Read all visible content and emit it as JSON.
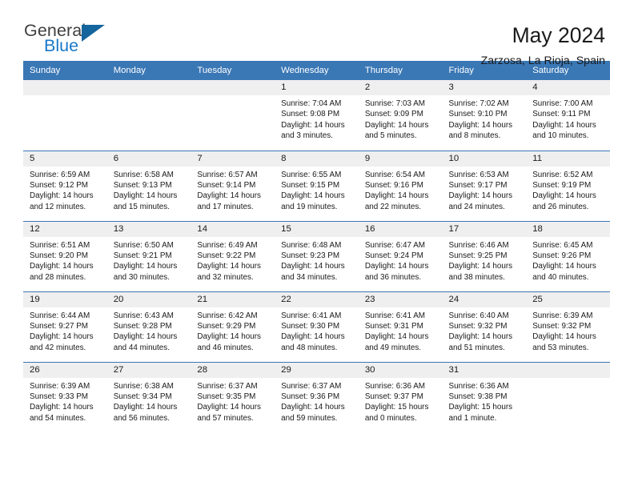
{
  "brand": {
    "name_part1": "General",
    "name_part2": "Blue",
    "triangle_color": "#14659e",
    "blue": "#1878c8"
  },
  "header": {
    "title": "May 2024",
    "subtitle": "Zarzosa, La Rioja, Spain"
  },
  "theme": {
    "header_bg": "#3a77b5",
    "daynum_bg": "#efefef",
    "row_border": "#3a77b5"
  },
  "weekday_headers": [
    "Sunday",
    "Monday",
    "Tuesday",
    "Wednesday",
    "Thursday",
    "Friday",
    "Saturday"
  ],
  "labels": {
    "sunrise_prefix": "Sunrise:",
    "sunset_prefix": "Sunset:",
    "daylight_prefix": "Daylight:"
  },
  "weeks": [
    [
      {
        "blank": true
      },
      {
        "blank": true
      },
      {
        "blank": true
      },
      {
        "day": "1",
        "sunrise": "Sunrise: 7:04 AM",
        "sunset": "Sunset: 9:08 PM",
        "daylight": "Daylight: 14 hours and 3 minutes."
      },
      {
        "day": "2",
        "sunrise": "Sunrise: 7:03 AM",
        "sunset": "Sunset: 9:09 PM",
        "daylight": "Daylight: 14 hours and 5 minutes."
      },
      {
        "day": "3",
        "sunrise": "Sunrise: 7:02 AM",
        "sunset": "Sunset: 9:10 PM",
        "daylight": "Daylight: 14 hours and 8 minutes."
      },
      {
        "day": "4",
        "sunrise": "Sunrise: 7:00 AM",
        "sunset": "Sunset: 9:11 PM",
        "daylight": "Daylight: 14 hours and 10 minutes."
      }
    ],
    [
      {
        "day": "5",
        "sunrise": "Sunrise: 6:59 AM",
        "sunset": "Sunset: 9:12 PM",
        "daylight": "Daylight: 14 hours and 12 minutes."
      },
      {
        "day": "6",
        "sunrise": "Sunrise: 6:58 AM",
        "sunset": "Sunset: 9:13 PM",
        "daylight": "Daylight: 14 hours and 15 minutes."
      },
      {
        "day": "7",
        "sunrise": "Sunrise: 6:57 AM",
        "sunset": "Sunset: 9:14 PM",
        "daylight": "Daylight: 14 hours and 17 minutes."
      },
      {
        "day": "8",
        "sunrise": "Sunrise: 6:55 AM",
        "sunset": "Sunset: 9:15 PM",
        "daylight": "Daylight: 14 hours and 19 minutes."
      },
      {
        "day": "9",
        "sunrise": "Sunrise: 6:54 AM",
        "sunset": "Sunset: 9:16 PM",
        "daylight": "Daylight: 14 hours and 22 minutes."
      },
      {
        "day": "10",
        "sunrise": "Sunrise: 6:53 AM",
        "sunset": "Sunset: 9:17 PM",
        "daylight": "Daylight: 14 hours and 24 minutes."
      },
      {
        "day": "11",
        "sunrise": "Sunrise: 6:52 AM",
        "sunset": "Sunset: 9:19 PM",
        "daylight": "Daylight: 14 hours and 26 minutes."
      }
    ],
    [
      {
        "day": "12",
        "sunrise": "Sunrise: 6:51 AM",
        "sunset": "Sunset: 9:20 PM",
        "daylight": "Daylight: 14 hours and 28 minutes."
      },
      {
        "day": "13",
        "sunrise": "Sunrise: 6:50 AM",
        "sunset": "Sunset: 9:21 PM",
        "daylight": "Daylight: 14 hours and 30 minutes."
      },
      {
        "day": "14",
        "sunrise": "Sunrise: 6:49 AM",
        "sunset": "Sunset: 9:22 PM",
        "daylight": "Daylight: 14 hours and 32 minutes."
      },
      {
        "day": "15",
        "sunrise": "Sunrise: 6:48 AM",
        "sunset": "Sunset: 9:23 PM",
        "daylight": "Daylight: 14 hours and 34 minutes."
      },
      {
        "day": "16",
        "sunrise": "Sunrise: 6:47 AM",
        "sunset": "Sunset: 9:24 PM",
        "daylight": "Daylight: 14 hours and 36 minutes."
      },
      {
        "day": "17",
        "sunrise": "Sunrise: 6:46 AM",
        "sunset": "Sunset: 9:25 PM",
        "daylight": "Daylight: 14 hours and 38 minutes."
      },
      {
        "day": "18",
        "sunrise": "Sunrise: 6:45 AM",
        "sunset": "Sunset: 9:26 PM",
        "daylight": "Daylight: 14 hours and 40 minutes."
      }
    ],
    [
      {
        "day": "19",
        "sunrise": "Sunrise: 6:44 AM",
        "sunset": "Sunset: 9:27 PM",
        "daylight": "Daylight: 14 hours and 42 minutes."
      },
      {
        "day": "20",
        "sunrise": "Sunrise: 6:43 AM",
        "sunset": "Sunset: 9:28 PM",
        "daylight": "Daylight: 14 hours and 44 minutes."
      },
      {
        "day": "21",
        "sunrise": "Sunrise: 6:42 AM",
        "sunset": "Sunset: 9:29 PM",
        "daylight": "Daylight: 14 hours and 46 minutes."
      },
      {
        "day": "22",
        "sunrise": "Sunrise: 6:41 AM",
        "sunset": "Sunset: 9:30 PM",
        "daylight": "Daylight: 14 hours and 48 minutes."
      },
      {
        "day": "23",
        "sunrise": "Sunrise: 6:41 AM",
        "sunset": "Sunset: 9:31 PM",
        "daylight": "Daylight: 14 hours and 49 minutes."
      },
      {
        "day": "24",
        "sunrise": "Sunrise: 6:40 AM",
        "sunset": "Sunset: 9:32 PM",
        "daylight": "Daylight: 14 hours and 51 minutes."
      },
      {
        "day": "25",
        "sunrise": "Sunrise: 6:39 AM",
        "sunset": "Sunset: 9:32 PM",
        "daylight": "Daylight: 14 hours and 53 minutes."
      }
    ],
    [
      {
        "day": "26",
        "sunrise": "Sunrise: 6:39 AM",
        "sunset": "Sunset: 9:33 PM",
        "daylight": "Daylight: 14 hours and 54 minutes."
      },
      {
        "day": "27",
        "sunrise": "Sunrise: 6:38 AM",
        "sunset": "Sunset: 9:34 PM",
        "daylight": "Daylight: 14 hours and 56 minutes."
      },
      {
        "day": "28",
        "sunrise": "Sunrise: 6:37 AM",
        "sunset": "Sunset: 9:35 PM",
        "daylight": "Daylight: 14 hours and 57 minutes."
      },
      {
        "day": "29",
        "sunrise": "Sunrise: 6:37 AM",
        "sunset": "Sunset: 9:36 PM",
        "daylight": "Daylight: 14 hours and 59 minutes."
      },
      {
        "day": "30",
        "sunrise": "Sunrise: 6:36 AM",
        "sunset": "Sunset: 9:37 PM",
        "daylight": "Daylight: 15 hours and 0 minutes."
      },
      {
        "day": "31",
        "sunrise": "Sunrise: 6:36 AM",
        "sunset": "Sunset: 9:38 PM",
        "daylight": "Daylight: 15 hours and 1 minute."
      },
      {
        "blank": true
      }
    ]
  ]
}
